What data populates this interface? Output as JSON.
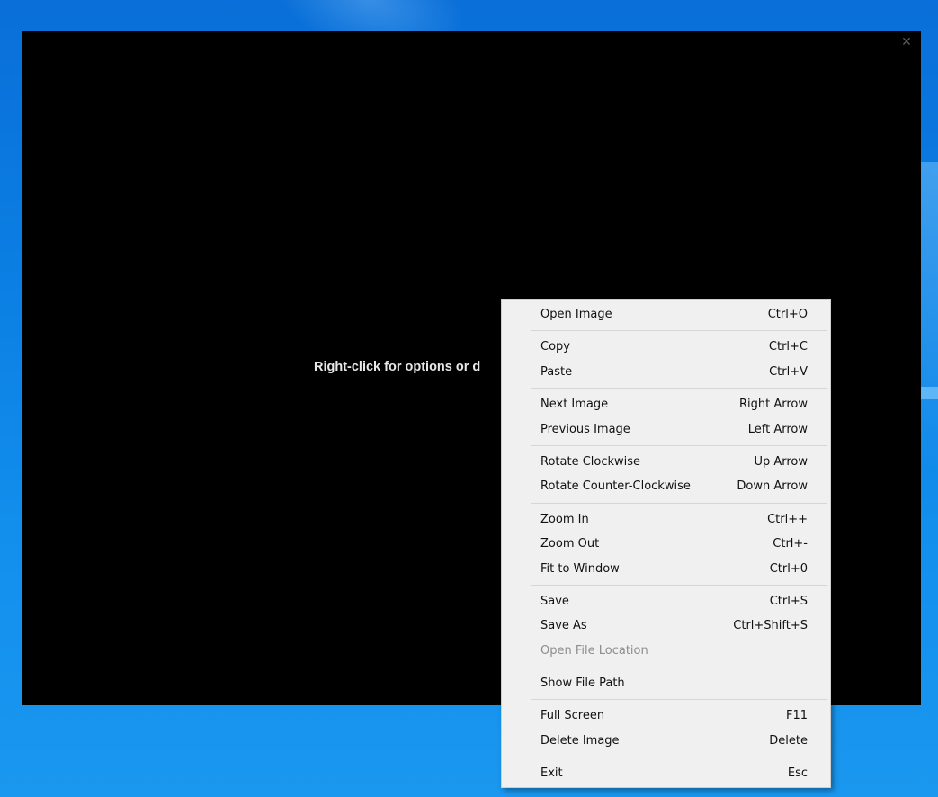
{
  "viewer": {
    "hint_text": "Right-click for options or d",
    "close_glyph": "✕"
  },
  "context_menu": {
    "groups": [
      [
        {
          "label": "Open Image",
          "shortcut": "Ctrl+O"
        }
      ],
      [
        {
          "label": "Copy",
          "shortcut": "Ctrl+C"
        },
        {
          "label": "Paste",
          "shortcut": "Ctrl+V"
        }
      ],
      [
        {
          "label": "Next Image",
          "shortcut": "Right Arrow"
        },
        {
          "label": "Previous Image",
          "shortcut": "Left Arrow"
        }
      ],
      [
        {
          "label": "Rotate Clockwise",
          "shortcut": "Up Arrow"
        },
        {
          "label": "Rotate Counter-Clockwise",
          "shortcut": "Down Arrow"
        }
      ],
      [
        {
          "label": "Zoom In",
          "shortcut": "Ctrl++"
        },
        {
          "label": "Zoom Out",
          "shortcut": "Ctrl+-"
        },
        {
          "label": "Fit to Window",
          "shortcut": "Ctrl+0"
        }
      ],
      [
        {
          "label": "Save",
          "shortcut": "Ctrl+S"
        },
        {
          "label": "Save As",
          "shortcut": "Ctrl+Shift+S"
        },
        {
          "label": "Open File Location",
          "shortcut": "",
          "disabled": true
        }
      ],
      [
        {
          "label": "Show File Path",
          "shortcut": ""
        }
      ],
      [
        {
          "label": "Full Screen",
          "shortcut": "F11"
        },
        {
          "label": "Delete Image",
          "shortcut": "Delete"
        }
      ],
      [
        {
          "label": "Exit",
          "shortcut": "Esc"
        }
      ]
    ]
  }
}
